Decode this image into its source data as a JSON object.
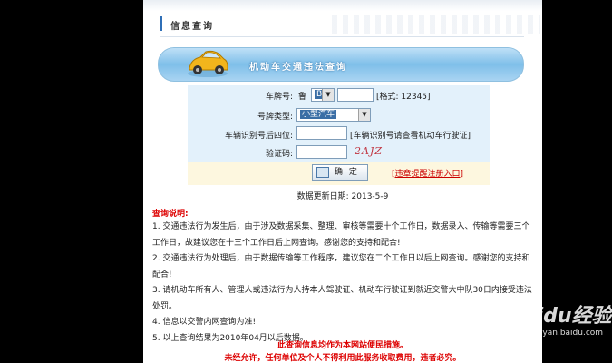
{
  "header": {
    "title": "信息查询"
  },
  "banner": {
    "title": "机动车交通违法查询"
  },
  "form": {
    "plate_label": "车牌号:",
    "plate_prefix": "鲁",
    "plate_letter": "B",
    "plate_value": "",
    "plate_format": "[格式: 12345]",
    "type_label": "号牌类型:",
    "type_value": "小型汽车",
    "vin_label": "车辆识别号后四位:",
    "vin_value": "",
    "vin_hint": "[车辆识别号请查看机动车行驶证]",
    "captcha_label": "验证码:",
    "captcha_value": "",
    "captcha_text": "2AJZ",
    "submit_label": "确 定",
    "register_link": "违章提醒注册入口",
    "register_prefix": "[",
    "register_suffix": "]"
  },
  "update": {
    "text": "数据更新日期:  2013-5-9"
  },
  "notes": {
    "title": "查询说明:",
    "items": [
      "1. 交通违法行为发生后，由于涉及数据采集、整理、审核等需要十个工作日，数据录入、传输等需要三个工作日，故建议您在十三个工作日后上网查询。感谢您的支持和配合!",
      "2. 交通违法行为处理后，由于数据传输等工作程序，建议您在二个工作日以后上网查询。感谢您的支持和配合!",
      "3. 请机动车所有人、管理人或违法行为人持本人驾驶证、机动车行驶证到就近交警大中队30日内接受违法处罚。",
      "4. 信息以交警内网查询为准!",
      "5. 以上查询结果为2010年04月以后数据。"
    ]
  },
  "footer": {
    "line1": "此查询信息均作为本网站便民措施。",
    "line2": "未经允许，任何单位及个人不得利用此服务收取费用，违者必究。"
  },
  "watermark": {
    "main": "Baidu经验",
    "sub": "jingyan.baidu.com"
  },
  "colors": {
    "accent": "#2f6fb7",
    "alert": "#dd0000",
    "form_bg": "#e3f1fb",
    "footer_bg": "#fdf7df"
  }
}
